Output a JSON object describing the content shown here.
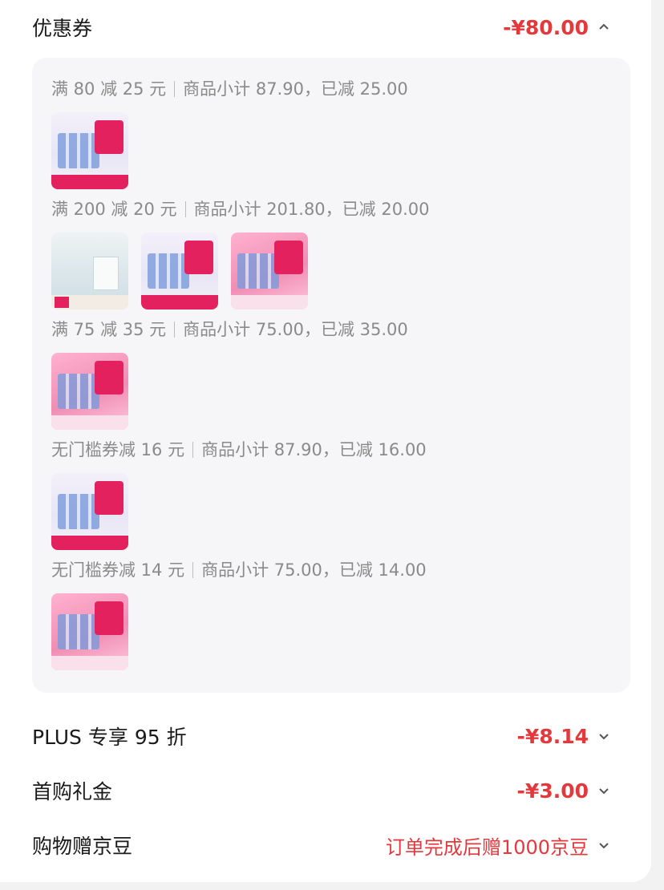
{
  "coupon": {
    "title": "优惠券",
    "amount": "-¥80.00"
  },
  "groups": [
    {
      "rule": "满 80 减 25 元",
      "summary": "商品小计 87.90，已减 25.00"
    },
    {
      "rule": "满 200 减 20 元",
      "summary": "商品小计 201.80，已减 20.00"
    },
    {
      "rule": "满 75 减 35 元",
      "summary": "商品小计 75.00，已减 35.00"
    },
    {
      "rule": "无门槛券减 16 元",
      "summary": "商品小计 87.90，已减 16.00"
    },
    {
      "rule": "无门槛券减 14 元",
      "summary": "商品小计 75.00，已减 14.00"
    }
  ],
  "rows": {
    "plus": {
      "title": "PLUS 专享 95 折",
      "value": "-¥8.14"
    },
    "first": {
      "title": "首购礼金",
      "value": "-¥3.00"
    },
    "beans": {
      "title": "购物赠京豆",
      "value": "订单完成后赠1000京豆"
    }
  },
  "icons": {
    "collapse": "chevron-up-icon",
    "expand": "chevron-down-icon"
  },
  "colors": {
    "accent": "#e4393c",
    "panel": "#f6f6f8",
    "muted_text": "#8a8a8a"
  }
}
